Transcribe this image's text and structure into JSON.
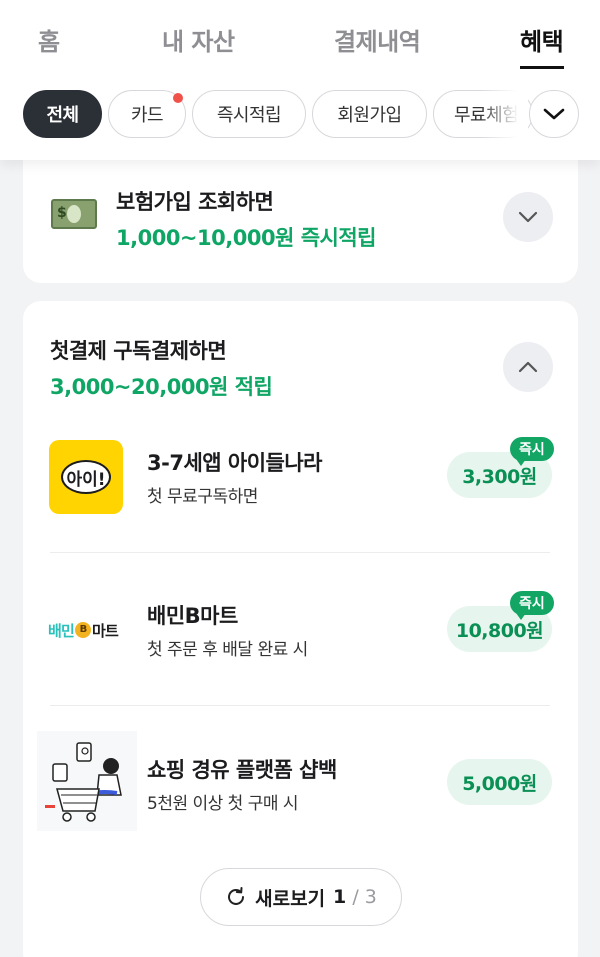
{
  "tabs": [
    {
      "label": "홈"
    },
    {
      "label": "내 자산"
    },
    {
      "label": "결제내역"
    },
    {
      "label": "혜택"
    }
  ],
  "active_tab": "혜택",
  "chips": [
    {
      "label": "전체",
      "active": true
    },
    {
      "label": "카드",
      "has_dot": true
    },
    {
      "label": "즉시적립"
    },
    {
      "label": "회원가입"
    },
    {
      "label": "무료체험"
    }
  ],
  "chips_expand_icon": "chevron-down-icon",
  "insurance_card": {
    "icon": "money-icon",
    "icon_text": "$",
    "title": "보험가입 조회하면",
    "reward": "1,000~10,000원 즉시적립",
    "toggle_icon": "chevron-down-icon"
  },
  "subscription_card": {
    "title": "첫결제 구독결제하면",
    "reward": "3,000~20,000원 적립",
    "toggle_icon": "chevron-up-icon",
    "items": [
      {
        "logo_text": "아이!",
        "name": "3-7세앱 아이들나라",
        "desc": "첫 무료구독하면",
        "amount": "3,300원",
        "badge": "즉시"
      },
      {
        "logo_text_1": "배민",
        "logo_coin": "B",
        "logo_text_2": "마트",
        "name": "배민B마트",
        "desc": "첫 주문 후 배달 완료 시",
        "amount": "10,800원",
        "badge": "즉시"
      },
      {
        "name": "쇼핑 경유 플랫폼 샵백",
        "desc": "5천원 이상 첫 구매 시",
        "amount": "5,000원"
      }
    ],
    "refresh": {
      "label": "새로보기",
      "page": "1",
      "separator": "/",
      "total": "3",
      "icon": "refresh-icon"
    }
  },
  "colors": {
    "accent_green": "#0fa665",
    "badge_green": "#12a564",
    "notification_dot": "#f0524a"
  }
}
